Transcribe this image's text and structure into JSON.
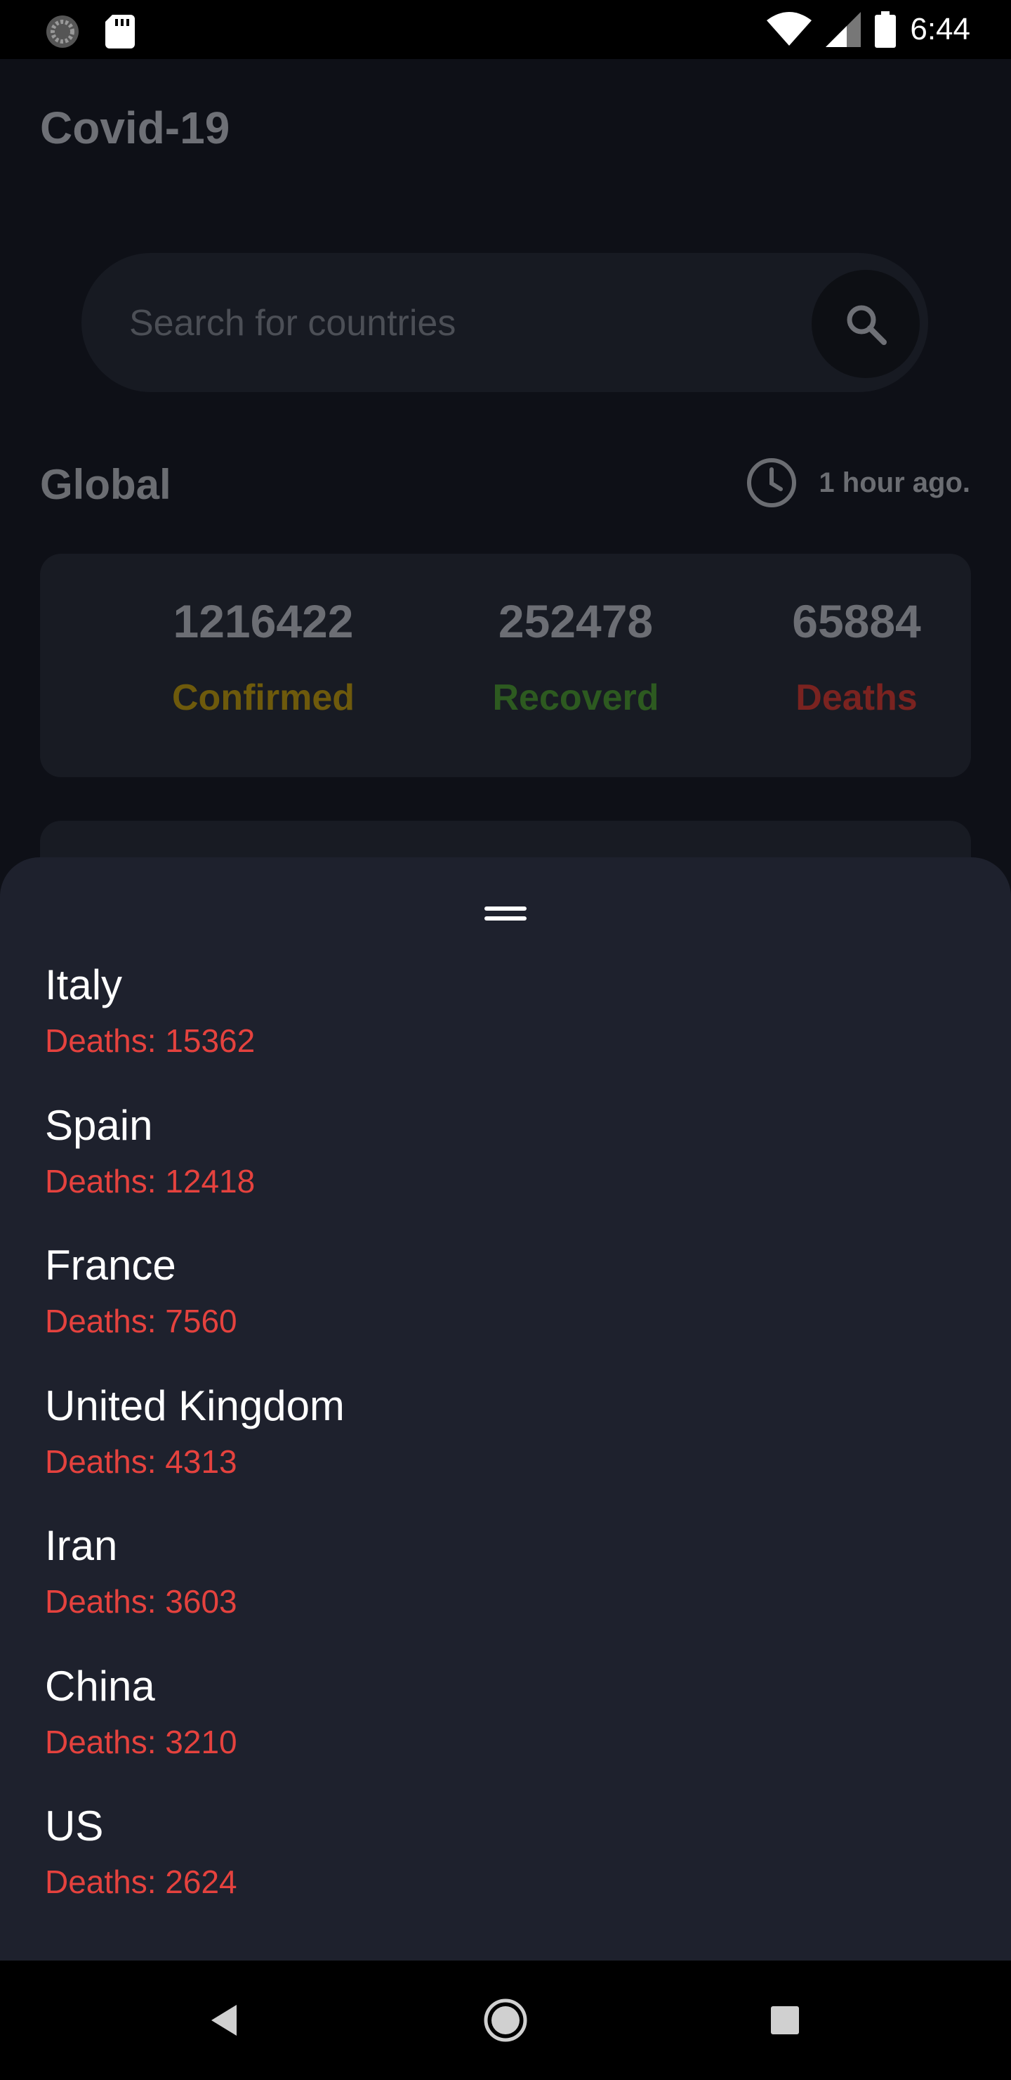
{
  "status_bar": {
    "time": "6:44",
    "icons": [
      "sync-icon",
      "sd-card-icon",
      "wifi-icon",
      "signal-icon",
      "battery-icon"
    ]
  },
  "app": {
    "title": "Covid-19"
  },
  "search": {
    "placeholder": "Search for countries"
  },
  "global": {
    "label": "Global",
    "updated": "1 hour ago.",
    "stats": {
      "confirmed": {
        "value": "1216422",
        "label": "Confirmed",
        "color": "#6e5a0c"
      },
      "recovered": {
        "value": "252478",
        "label": "Recoverd",
        "color": "#2d5a20"
      },
      "deaths": {
        "value": "65884",
        "label": "Deaths",
        "color": "#7a2320"
      }
    }
  },
  "sheet": {
    "countries": [
      {
        "name": "Italy",
        "deaths": "Deaths: 15362"
      },
      {
        "name": "Spain",
        "deaths": "Deaths: 12418"
      },
      {
        "name": "France",
        "deaths": "Deaths: 7560"
      },
      {
        "name": "United Kingdom",
        "deaths": "Deaths: 4313"
      },
      {
        "name": "Iran",
        "deaths": "Deaths: 3603"
      },
      {
        "name": "China",
        "deaths": "Deaths: 3210"
      },
      {
        "name": "US",
        "deaths": "Deaths: 2624"
      }
    ]
  },
  "colors": {
    "accent_deaths": "#e5423e",
    "sheet_bg": "#1e212d",
    "app_bg": "#0e1017"
  }
}
